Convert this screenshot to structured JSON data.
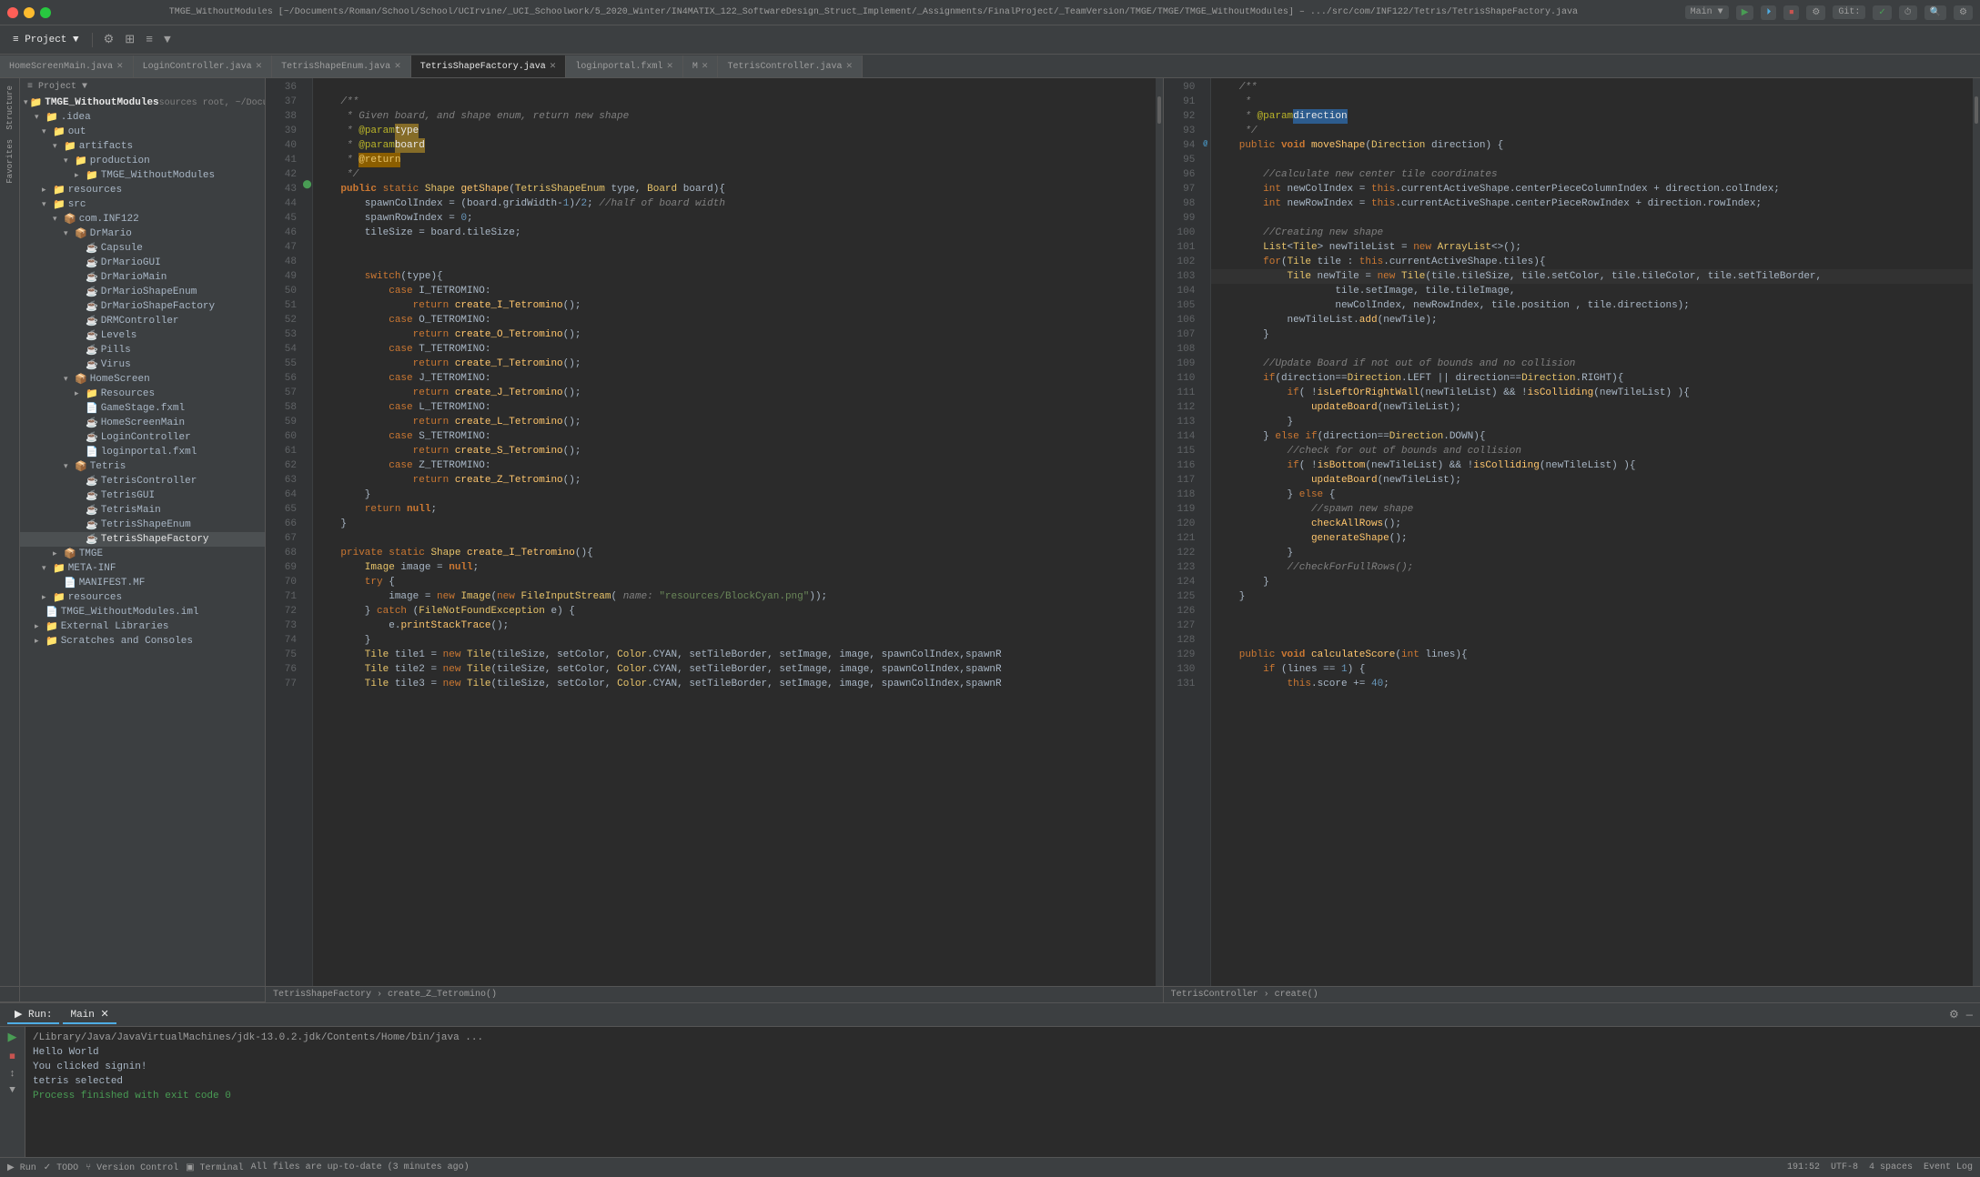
{
  "titlebar": {
    "text": "TMGE_WithoutModules [~/Documents/Roman/School/School/UCIrvine/_UCI_Schoolwork/5_2020_Winter/IN4MATIX_122_SoftwareDesign_Struct_Implement/_Assignments/FinalProject/_TeamVersion/TMGE/TMGE/TMGE_WithoutModules] – .../src/com/INF122/Tetris/TetrisShapeFactory.java",
    "buttons": [
      "Main ▼",
      "▶",
      "⏹",
      "⚙",
      "Git:",
      "✓",
      "⏱",
      "🔍",
      "⚙"
    ]
  },
  "toolbar": {
    "project_label": "Project ▼",
    "icons": [
      "⚙",
      "≡",
      "☰",
      "▼"
    ]
  },
  "tabs": [
    {
      "label": "HomeScreenMain.java",
      "active": false
    },
    {
      "label": "LoginController.java",
      "active": false
    },
    {
      "label": "TetrisShapeEnum.java",
      "active": false
    },
    {
      "label": "TetrisShapeFactory.java",
      "active": true
    },
    {
      "label": "loginportal.fxml",
      "active": false
    },
    {
      "label": "M",
      "active": false
    },
    {
      "label": "TetrisController.java",
      "active": false
    }
  ],
  "sidebar": {
    "project_label": "Project ▼",
    "tree": [
      {
        "indent": 0,
        "icon": "▾",
        "type": "folder",
        "label": "TMGE_WithoutModules",
        "suffix": " sources root, ~/Docum..."
      },
      {
        "indent": 1,
        "icon": "▾",
        "type": "folder",
        "label": "idea"
      },
      {
        "indent": 2,
        "icon": "▾",
        "type": "folder",
        "label": "out"
      },
      {
        "indent": 3,
        "icon": "▾",
        "type": "folder",
        "label": "artifacts"
      },
      {
        "indent": 4,
        "icon": "▾",
        "type": "folder",
        "label": "production"
      },
      {
        "indent": 5,
        "icon": "▾",
        "type": "folder",
        "label": "TMGE_WithoutModules"
      },
      {
        "indent": 2,
        "icon": "▸",
        "type": "folder",
        "label": "resources"
      },
      {
        "indent": 2,
        "icon": "▾",
        "type": "folder",
        "label": "src"
      },
      {
        "indent": 3,
        "icon": "▾",
        "type": "folder",
        "label": "com.INF122"
      },
      {
        "indent": 4,
        "icon": "▾",
        "type": "folder",
        "label": "DrMario"
      },
      {
        "indent": 5,
        "icon": "○",
        "type": "java",
        "label": "Capsule"
      },
      {
        "indent": 5,
        "icon": "○",
        "type": "java",
        "label": "DrMarioGUI"
      },
      {
        "indent": 5,
        "icon": "○",
        "type": "java",
        "label": "DrMarioMain"
      },
      {
        "indent": 5,
        "icon": "○",
        "type": "java",
        "label": "DrMarioShapeEnum"
      },
      {
        "indent": 5,
        "icon": "○",
        "type": "java",
        "label": "DrMarioShapeFactory"
      },
      {
        "indent": 5,
        "icon": "○",
        "type": "java",
        "label": "DRMController"
      },
      {
        "indent": 5,
        "icon": "○",
        "type": "java",
        "label": "Levels"
      },
      {
        "indent": 5,
        "icon": "○",
        "type": "java",
        "label": "Pills"
      },
      {
        "indent": 5,
        "icon": "○",
        "type": "java",
        "label": "Virus"
      },
      {
        "indent": 4,
        "icon": "▾",
        "type": "folder",
        "label": "HomeScreen"
      },
      {
        "indent": 5,
        "icon": "▸",
        "type": "folder",
        "label": "Resources"
      },
      {
        "indent": 5,
        "icon": "□",
        "type": "fxml",
        "label": "GameStage.fxml"
      },
      {
        "indent": 5,
        "icon": "○",
        "type": "java",
        "label": "HomeScreenMain"
      },
      {
        "indent": 5,
        "icon": "○",
        "type": "java",
        "label": "LoginController"
      },
      {
        "indent": 5,
        "icon": "□",
        "type": "fxml",
        "label": "loginportal.fxml"
      },
      {
        "indent": 4,
        "icon": "▾",
        "type": "folder",
        "label": "Tetris"
      },
      {
        "indent": 5,
        "icon": "○",
        "type": "java",
        "label": "TetrisController"
      },
      {
        "indent": 5,
        "icon": "○",
        "type": "java",
        "label": "TetrisGUI"
      },
      {
        "indent": 5,
        "icon": "○",
        "type": "java",
        "label": "TetrisMain"
      },
      {
        "indent": 5,
        "icon": "○",
        "type": "java",
        "label": "TetrisShapeEnum"
      },
      {
        "indent": 5,
        "icon": "●",
        "type": "java",
        "label": "TetrisShapeFactory",
        "selected": true
      },
      {
        "indent": 3,
        "icon": "▸",
        "type": "folder",
        "label": "TMGE"
      },
      {
        "indent": 2,
        "icon": "▾",
        "type": "folder",
        "label": "META-INF"
      },
      {
        "indent": 3,
        "icon": "□",
        "type": "xml",
        "label": "MANIFEST.MF"
      },
      {
        "indent": 2,
        "icon": "▸",
        "type": "folder",
        "label": "resources"
      },
      {
        "indent": 1,
        "icon": "□",
        "type": "xml",
        "label": "TMGE_WithoutModules.iml"
      },
      {
        "indent": 1,
        "icon": "▸",
        "type": "folder",
        "label": "External Libraries"
      },
      {
        "indent": 1,
        "icon": "▸",
        "type": "folder",
        "label": "Scratches and Consoles"
      }
    ]
  },
  "code_left": {
    "breadcrumb": "TetrisShapeFactory › create_Z_Tetromino()",
    "lines": [
      {
        "num": 36,
        "content": ""
      },
      {
        "num": 37,
        "content": "    /**",
        "type": "comment"
      },
      {
        "num": 38,
        "content": "     * Given board, and shape enum, return new shape",
        "type": "comment"
      },
      {
        "num": 39,
        "content": "     * @param type",
        "type": "comment",
        "highlight": "type"
      },
      {
        "num": 40,
        "content": "     * @param board",
        "type": "comment",
        "highlight": "board"
      },
      {
        "num": 41,
        "content": "     * @return",
        "type": "comment",
        "highlight": "return"
      },
      {
        "num": 42,
        "content": "     */",
        "type": "comment"
      },
      {
        "num": 43,
        "content": "    public static Shape getShape(TetrisShapeEnum type, Board board){",
        "type": "code"
      },
      {
        "num": 44,
        "content": "        spawnColIndex = (board.gridWidth-1)/2; //half of board width",
        "type": "code"
      },
      {
        "num": 45,
        "content": "        spawnRowIndex = 0;",
        "type": "code"
      },
      {
        "num": 46,
        "content": "        tileSize = board.tileSize;",
        "type": "code"
      },
      {
        "num": 47,
        "content": ""
      },
      {
        "num": 48,
        "content": ""
      },
      {
        "num": 49,
        "content": "        switch(type){",
        "type": "code"
      },
      {
        "num": 50,
        "content": "            case I_TETROMINO:",
        "type": "code"
      },
      {
        "num": 51,
        "content": "                return create_I_Tetromino();",
        "type": "code"
      },
      {
        "num": 52,
        "content": "            case O_TETROMINO:",
        "type": "code"
      },
      {
        "num": 53,
        "content": "                return create_O_Tetromino();",
        "type": "code"
      },
      {
        "num": 54,
        "content": "            case T_TETROMINO:",
        "type": "code"
      },
      {
        "num": 55,
        "content": "                return create_T_Tetromino();",
        "type": "code"
      },
      {
        "num": 56,
        "content": "            case J_TETROMINO:",
        "type": "code"
      },
      {
        "num": 57,
        "content": "                return create_J_Tetromino();",
        "type": "code"
      },
      {
        "num": 58,
        "content": "            case L_TETROMINO:",
        "type": "code"
      },
      {
        "num": 59,
        "content": "                return create_L_Tetromino();",
        "type": "code"
      },
      {
        "num": 60,
        "content": "            case S_TETROMINO:",
        "type": "code"
      },
      {
        "num": 61,
        "content": "                return create_S_Tetromino();",
        "type": "code"
      },
      {
        "num": 62,
        "content": "            case Z_TETROMINO:",
        "type": "code"
      },
      {
        "num": 63,
        "content": "                return create_Z_Tetromino();",
        "type": "code"
      },
      {
        "num": 64,
        "content": "        }",
        "type": "code"
      },
      {
        "num": 65,
        "content": "        return null;",
        "type": "code"
      },
      {
        "num": 66,
        "content": "    }",
        "type": "code"
      },
      {
        "num": 67,
        "content": ""
      },
      {
        "num": 68,
        "content": "    private static Shape create_I_Tetromino(){",
        "type": "code"
      },
      {
        "num": 69,
        "content": "        Image image = null;",
        "type": "code"
      },
      {
        "num": 70,
        "content": "        try {",
        "type": "code"
      },
      {
        "num": 71,
        "content": "            image = new Image(new FileInputStream( name: \"resources/BlockCyan.png\"));",
        "type": "code"
      },
      {
        "num": 72,
        "content": "        } catch (FileNotFoundException e) {",
        "type": "code"
      },
      {
        "num": 73,
        "content": "            e.printStackTrace();",
        "type": "code"
      },
      {
        "num": 74,
        "content": "        }",
        "type": "code"
      },
      {
        "num": 75,
        "content": "        Tile tile1 = new Tile(tileSize, setColor, Color.CYAN, setTileBorder, setImage, image, spawnColIndex,spawnR",
        "type": "code"
      },
      {
        "num": 76,
        "content": "        Tile tile2 = new Tile(tileSize, setColor, Color.CYAN, setTileBorder, setImage, image, spawnColIndex,spawnR",
        "type": "code"
      },
      {
        "num": 77,
        "content": "        Tile tile3 = new Tile(tileSize, setColor, Color.CYAN, setTileBorder, setImage, image, spawnColIndex,spawnR",
        "type": "code"
      }
    ]
  },
  "code_right": {
    "breadcrumb": "TetrisController › create()",
    "lines": [
      {
        "num": 90,
        "content": "    /**",
        "type": "comment"
      },
      {
        "num": 91,
        "content": "     *",
        "type": "comment"
      },
      {
        "num": 92,
        "content": "     * @param direction",
        "type": "comment"
      },
      {
        "num": 93,
        "content": "     */",
        "type": "comment"
      },
      {
        "num": 94,
        "content": "    public void moveShape(Direction direction) {",
        "type": "code"
      },
      {
        "num": 95,
        "content": ""
      },
      {
        "num": 96,
        "content": "        //calculate new center tile coordinates",
        "type": "comment"
      },
      {
        "num": 97,
        "content": "        int newColIndex = this.currentActiveShape.centerPieceColumnIndex + direction.colIndex;",
        "type": "code"
      },
      {
        "num": 98,
        "content": "        int newRowIndex = this.currentActiveShape.centerPieceRowIndex + direction.rowIndex;",
        "type": "code"
      },
      {
        "num": 99,
        "content": ""
      },
      {
        "num": 100,
        "content": "        //Creating new shape",
        "type": "comment"
      },
      {
        "num": 101,
        "content": "        List<Tile> newTileList = new ArrayList<>();",
        "type": "code"
      },
      {
        "num": 102,
        "content": "        for(Tile tile : this.currentActiveShape.tiles){",
        "type": "code"
      },
      {
        "num": 103,
        "content": "            Tile newTile = new Tile(tile.tileSize, tile.setColor, tile.tileColor, tile.setTileBorder,",
        "type": "code"
      },
      {
        "num": 104,
        "content": "                    tile.setImage, tile.tileImage,",
        "type": "code"
      },
      {
        "num": 105,
        "content": "                    newColIndex, newRowIndex, tile.position , tile.directions);",
        "type": "code"
      },
      {
        "num": 106,
        "content": "            newTileList.add(newTile);",
        "type": "code"
      },
      {
        "num": 107,
        "content": "        }",
        "type": "code"
      },
      {
        "num": 108,
        "content": ""
      },
      {
        "num": 109,
        "content": "        //Update Board if not out of bounds and no collision",
        "type": "comment"
      },
      {
        "num": 110,
        "content": "        if(direction==Direction.LEFT || direction==Direction.RIGHT){",
        "type": "code"
      },
      {
        "num": 111,
        "content": "            if( !isLeftOrRightWall(newTileList) && !isColliding(newTileList) ){",
        "type": "code"
      },
      {
        "num": 112,
        "content": "                updateBoard(newTileList);",
        "type": "code"
      },
      {
        "num": 113,
        "content": "            }",
        "type": "code"
      },
      {
        "num": 114,
        "content": "        } else if(direction==Direction.DOWN){",
        "type": "code"
      },
      {
        "num": 115,
        "content": "            //check for out of bounds and collision",
        "type": "comment"
      },
      {
        "num": 116,
        "content": "            if( !isBottom(newTileList) && !isColliding(newTileList) ){",
        "type": "code"
      },
      {
        "num": 117,
        "content": "                updateBoard(newTileList);",
        "type": "code"
      },
      {
        "num": 118,
        "content": "            } else {",
        "type": "code"
      },
      {
        "num": 119,
        "content": "                //spawn new shape",
        "type": "comment"
      },
      {
        "num": 120,
        "content": "                checkAllRows();",
        "type": "code"
      },
      {
        "num": 121,
        "content": "                generateShape();",
        "type": "code"
      },
      {
        "num": 122,
        "content": "            }",
        "type": "code"
      },
      {
        "num": 123,
        "content": "            //checkForFullRows();",
        "type": "comment"
      },
      {
        "num": 124,
        "content": "        }",
        "type": "code"
      },
      {
        "num": 125,
        "content": "    }",
        "type": "code"
      },
      {
        "num": 126,
        "content": ""
      },
      {
        "num": 127,
        "content": ""
      },
      {
        "num": 128,
        "content": ""
      },
      {
        "num": 129,
        "content": "    public void calculateScore(int lines){",
        "type": "code"
      },
      {
        "num": 130,
        "content": "        if (lines == 1) {",
        "type": "code"
      },
      {
        "num": 131,
        "content": "            this.score += 40;",
        "type": "code"
      }
    ]
  },
  "bottom_panel": {
    "tabs": [
      "Run",
      "Main",
      "TODO",
      "Version Control",
      "Terminal"
    ],
    "active_tab": "Run",
    "run_config": "Main",
    "output_lines": [
      "/Library/Java/JavaVirtualMachines/jdk-13.0.2.jdk/Contents/Home/bin/java ...",
      "Hello World",
      "You clicked signin!",
      "tetris selected",
      "",
      "",
      "",
      "Process finished with exit code 0"
    ]
  },
  "statusbar": {
    "run_label": "▶ Run",
    "todo_label": "✓ TODO",
    "version_label": "⑂ Version Control",
    "terminal_label": "▣ Terminal",
    "position": "191:52",
    "encoding": "UTF-8",
    "indent": "4 spaces",
    "event_log": "Event Log",
    "git_status": "All files are up-to-date (3 minutes ago)"
  }
}
